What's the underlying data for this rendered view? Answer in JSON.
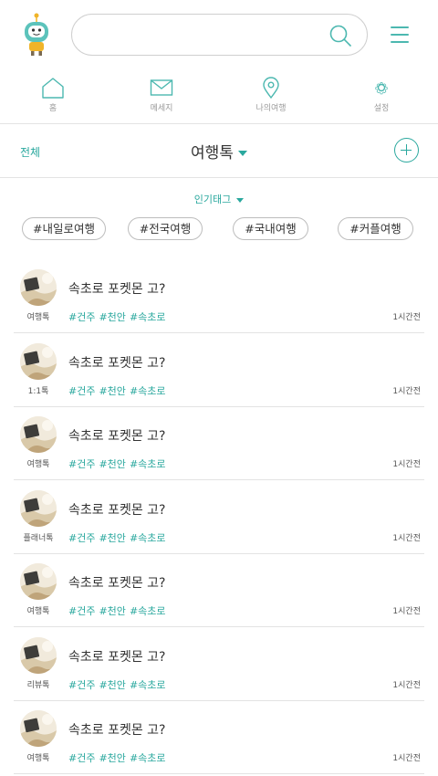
{
  "header": {
    "search": {
      "value": "",
      "placeholder": ""
    },
    "colors": {
      "accent": "#2aa89e",
      "logo_body": "#5cc3bb",
      "logo_accent": "#f0b429"
    }
  },
  "nav": [
    {
      "label": "홈",
      "icon": "home-icon"
    },
    {
      "label": "메세지",
      "icon": "mail-icon"
    },
    {
      "label": "나의여행",
      "icon": "map-pin-icon"
    },
    {
      "label": "설정",
      "icon": "gear-icon"
    }
  ],
  "category": {
    "all_label": "전체",
    "title": "여행톡"
  },
  "popular": {
    "label": "인기태그",
    "tags": [
      "#내일로여행",
      "#전국여행",
      "#국내여행",
      "#커플여행"
    ]
  },
  "posts": [
    {
      "category": "여행톡",
      "title": "속초로 포켓몬 고?",
      "tags": [
        "#건주",
        "#천안",
        "#속초로"
      ],
      "time": "1시간전"
    },
    {
      "category": "1:1톡",
      "title": "속초로 포켓몬 고?",
      "tags": [
        "#건주",
        "#천안",
        "#속초로"
      ],
      "time": "1시간전"
    },
    {
      "category": "여행톡",
      "title": "속초로 포켓몬 고?",
      "tags": [
        "#건주",
        "#천안",
        "#속초로"
      ],
      "time": "1시간전"
    },
    {
      "category": "플래너톡",
      "title": "속초로 포켓몬 고?",
      "tags": [
        "#건주",
        "#천안",
        "#속초로"
      ],
      "time": "1시간전"
    },
    {
      "category": "여행톡",
      "title": "속초로 포켓몬 고?",
      "tags": [
        "#건주",
        "#천안",
        "#속초로"
      ],
      "time": "1시간전"
    },
    {
      "category": "리뷰톡",
      "title": "속초로 포켓몬 고?",
      "tags": [
        "#건주",
        "#천안",
        "#속초로"
      ],
      "time": "1시간전"
    },
    {
      "category": "여행톡",
      "title": "속초로 포켓몬 고?",
      "tags": [
        "#건주",
        "#천안",
        "#속초로"
      ],
      "time": "1시간전"
    }
  ]
}
